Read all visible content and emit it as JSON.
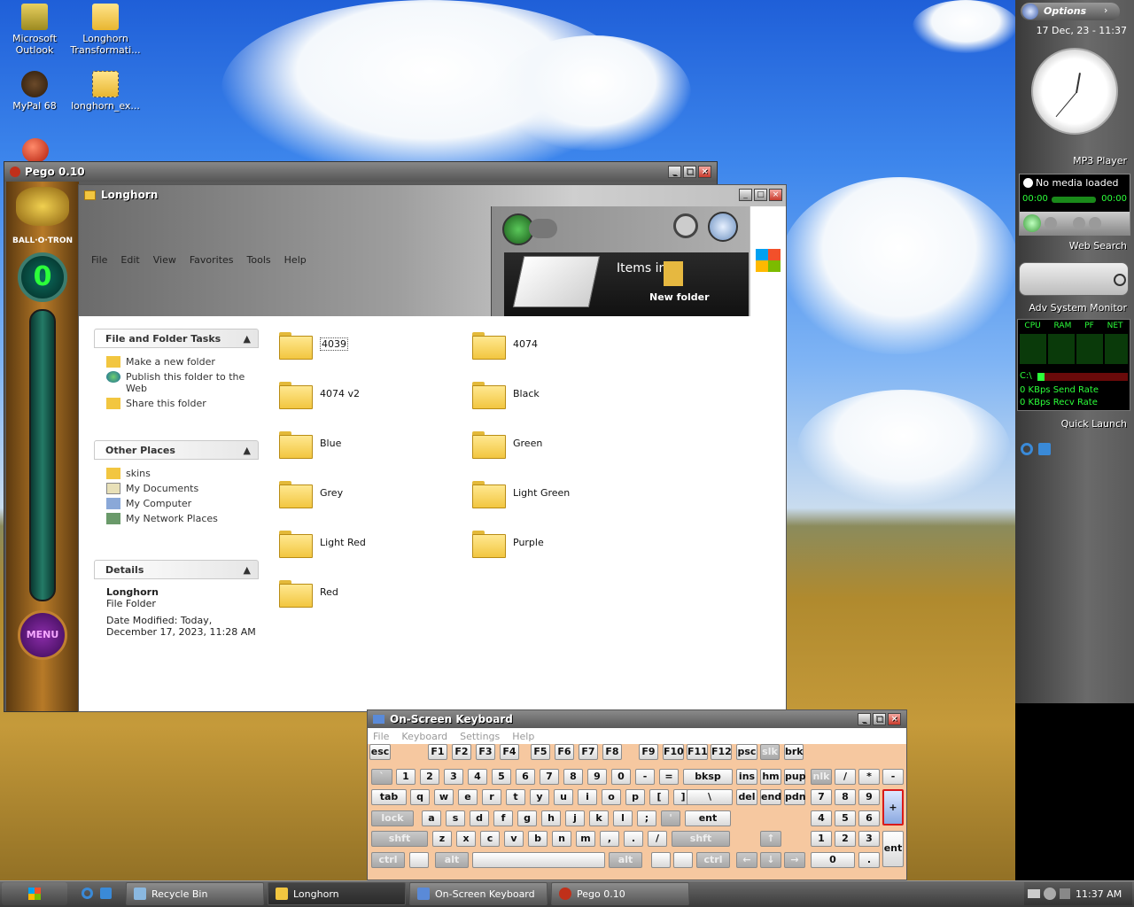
{
  "desktop": {
    "icons": [
      {
        "label": "Microsoft Outlook"
      },
      {
        "label": "Longhorn Transformati..."
      },
      {
        "label": "MyPal 68"
      },
      {
        "label": "longhorn_ex..."
      }
    ]
  },
  "pego": {
    "title": "Pego 0.10",
    "score": "0",
    "logo": "BALL·O·TRON",
    "menu": "MENU"
  },
  "explorer": {
    "title": "Longhorn",
    "menu": [
      "File",
      "Edit",
      "View",
      "Favorites",
      "Tools",
      "Help"
    ],
    "preview": {
      "items_label": "Items in",
      "new_folder": "New folder"
    },
    "tasks": {
      "header": "File and Folder Tasks",
      "items": [
        "Make a new folder",
        "Publish this folder to the Web",
        "Share this folder"
      ]
    },
    "places": {
      "header": "Other Places",
      "items": [
        "skins",
        "My Documents",
        "My Computer",
        "My Network Places"
      ]
    },
    "details": {
      "header": "Details",
      "name": "Longhorn",
      "type": "File Folder",
      "modified": "Date Modified: Today, December 17, 2023, 11:28 AM"
    },
    "folders": [
      "4039",
      "4074",
      "4074 v2",
      "Black",
      "Blue",
      "Green",
      "Grey",
      "Light Green",
      "Light Red",
      "Purple",
      "Red"
    ]
  },
  "sidebar": {
    "options": "Options",
    "datetime": "17 Dec, 23 - 11:37",
    "mp3": {
      "header": "MP3 Player",
      "status": "No media loaded",
      "time_left": "00:00",
      "time_right": "00:00"
    },
    "web_search": "Web Search",
    "monitor": {
      "header": "Adv System Monitor",
      "labels": [
        "CPU",
        "RAM",
        "PF",
        "NET"
      ],
      "drive": "C:\\",
      "send": "0 KBps Send Rate",
      "recv": "0 KBps Recv Rate"
    },
    "quick_launch": "Quick Launch"
  },
  "osk": {
    "title": "On-Screen Keyboard",
    "menu": [
      "File",
      "Keyboard",
      "Settings",
      "Help"
    ],
    "keys": [
      "esc",
      "F1",
      "F2",
      "F3",
      "F4",
      "F5",
      "F6",
      "F7",
      "F8",
      "F9",
      "F10",
      "F11",
      "F12",
      "psc",
      "slk",
      "brk",
      "`",
      "1",
      "2",
      "3",
      "4",
      "5",
      "6",
      "7",
      "8",
      "9",
      "0",
      "-",
      "=",
      "bksp",
      "ins",
      "hm",
      "pup",
      "nlk",
      "/",
      "*",
      "-",
      "tab",
      "q",
      "w",
      "e",
      "r",
      "t",
      "y",
      "u",
      "i",
      "o",
      "p",
      "[",
      "]",
      "\\",
      "del",
      "end",
      "pdn",
      "7",
      "8",
      "9",
      "+",
      "lock",
      "a",
      "s",
      "d",
      "f",
      "g",
      "h",
      "j",
      "k",
      "l",
      ";",
      "'",
      "ent",
      "4",
      "5",
      "6",
      "shft",
      "z",
      "x",
      "c",
      "v",
      "b",
      "n",
      "m",
      ",",
      ".",
      "/",
      "shft",
      "↑",
      "1",
      "2",
      "3",
      "ent",
      "ctrl",
      "alt",
      "alt",
      "ctrl",
      "←",
      "↓",
      "→",
      "0",
      "."
    ]
  },
  "taskbar": {
    "buttons": [
      "Recycle Bin",
      "Longhorn",
      "On-Screen Keyboard",
      "Pego 0.10"
    ],
    "clock": "11:37 AM"
  }
}
